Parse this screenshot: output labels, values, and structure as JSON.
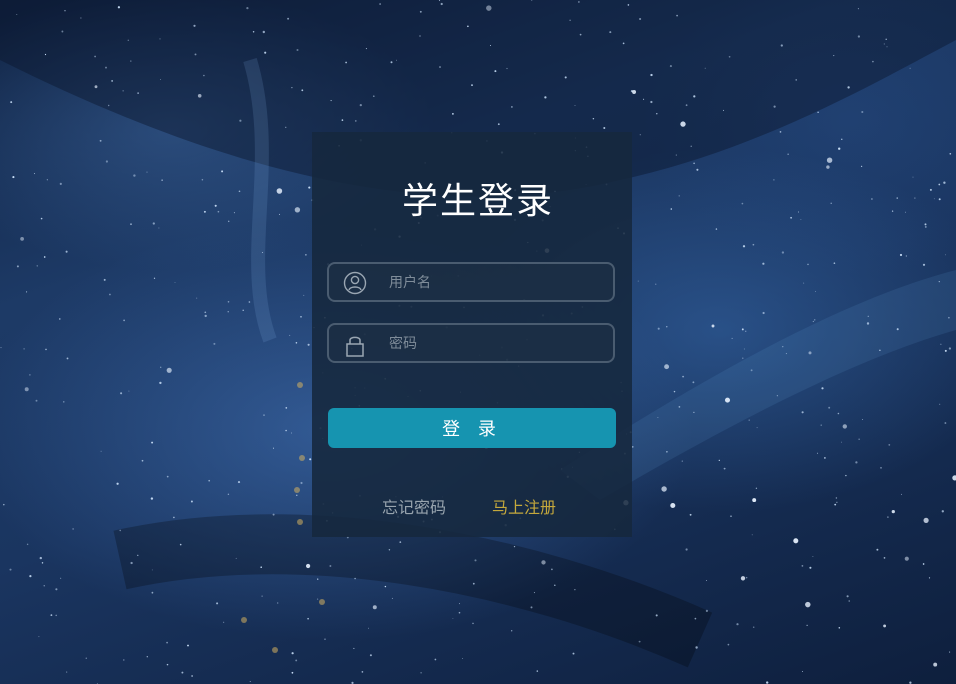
{
  "login": {
    "title": "学生登录",
    "username": {
      "placeholder": "用户名",
      "value": "",
      "icon": "user-icon"
    },
    "password": {
      "placeholder": "密码",
      "value": "",
      "icon": "lock-icon"
    },
    "submit_label": "登 录",
    "forgot_label": "忘记密码",
    "register_label": "马上注册"
  },
  "colors": {
    "panel": "#16283e",
    "button": "#1694b0",
    "forgot_link": "#98a4ae",
    "register_link": "#c4a83c"
  }
}
